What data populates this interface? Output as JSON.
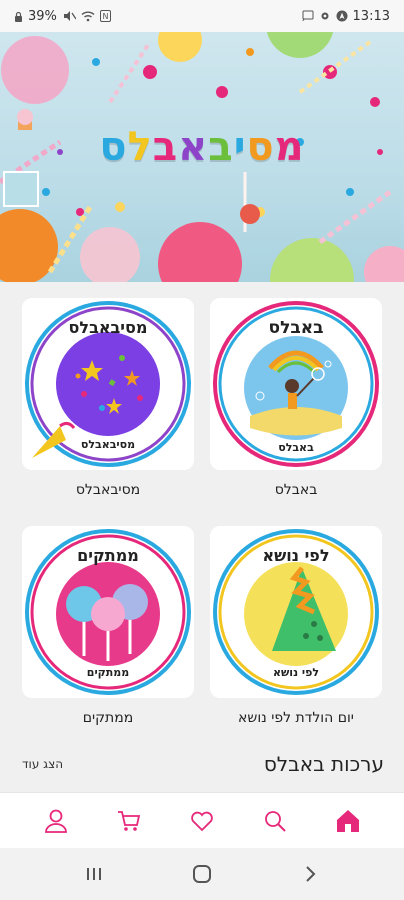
{
  "status_bar": {
    "battery": "39%",
    "time": "13:13"
  },
  "hero": {
    "title": "מסיבאבלס",
    "title_colors": [
      "#e6287a",
      "#f29a1f",
      "#2aa9e0",
      "#6bbf3a",
      "#8e44c9",
      "#e6287a",
      "#f2c61f",
      "#2aa9e0"
    ]
  },
  "categories": [
    {
      "card_title": "באבלס",
      "card_caption": "באבלס",
      "label": "באבלס",
      "ring_color": "#2aa9e0",
      "inner_color": "#2aa9e0"
    },
    {
      "card_title": "מסיבאבלס",
      "card_caption": "מסיבאבלס",
      "label": "מסיבאבלס",
      "ring_color": "#8e44c9",
      "inner_color": "#7b3fe4"
    },
    {
      "card_title": "לפי נושא",
      "card_caption": "לפי נושא",
      "label": "יום הולדת לפי נושא",
      "ring_color": "#2aa9e0",
      "inner_color": "#f5e05a"
    },
    {
      "card_title": "ממתקים",
      "card_caption": "ממתקים",
      "label": "ממתקים",
      "ring_color": "#e6287a",
      "inner_color": "#e83a8a"
    }
  ],
  "section": {
    "title": "ערכות באבלס",
    "show_more": "הצג עוד"
  },
  "bottom_nav": {
    "accent": "#e6287a",
    "items": [
      {
        "name": "profile",
        "icon": "user-icon"
      },
      {
        "name": "cart",
        "icon": "cart-icon"
      },
      {
        "name": "favorites",
        "icon": "heart-icon"
      },
      {
        "name": "search",
        "icon": "search-icon"
      },
      {
        "name": "home",
        "icon": "home-icon",
        "active": true
      }
    ]
  },
  "system_nav": {
    "items": [
      "recents-icon",
      "home-circle-icon",
      "back-icon"
    ]
  }
}
